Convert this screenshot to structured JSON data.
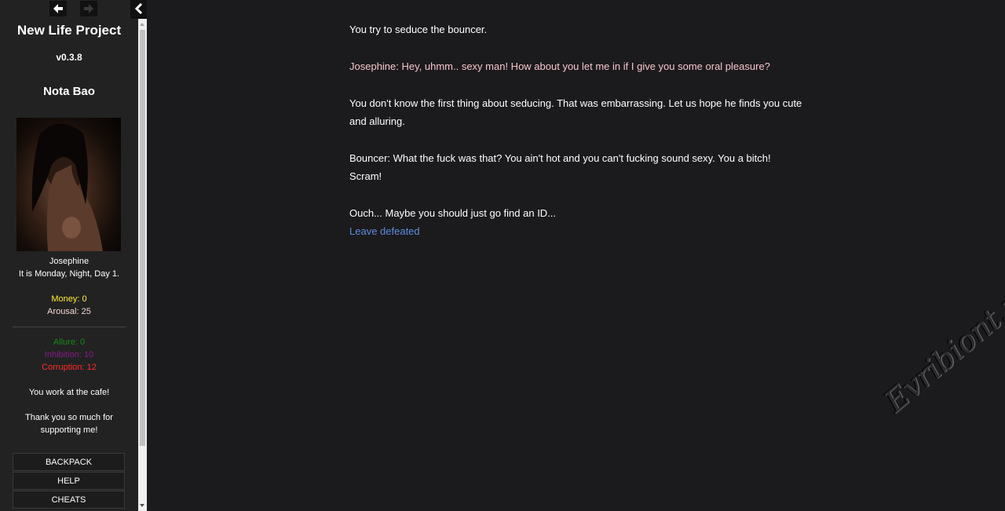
{
  "sidebar": {
    "game_title": "New Life Project",
    "version": "v0.3.8",
    "player_name": "Nota Bao",
    "character_name": "Josephine",
    "date_text": "It is Monday, Night, Day 1.",
    "money_text": "Money: 0",
    "arousal_text": "Arousal: 25",
    "allure_text": "Allure: 0",
    "inhibition_text": "Inhibition: 10",
    "corruption_text": "Corruption: 12",
    "job_text": "You work at the cafe!",
    "thanks_text": "Thank you so much for supporting me!",
    "menu": {
      "backpack": "BACKPACK",
      "help": "HELP",
      "cheats": "CHEATS"
    }
  },
  "passage": {
    "p1": "You try to seduce the bouncer.",
    "p2": "Josephine: Hey, uhmm.. sexy man! How about you let me in if I give you some oral pleasure?",
    "p3": "You don't know the first thing about seducing. That was embarrassing. Let us hope he finds you cute and alluring.",
    "p4": "Bouncer: What the fuck was that? You ain't hot and you can't fucking sound sexy. You a bitch! Scram!",
    "p5": "Ouch... Maybe you should just go find an ID...",
    "link": "Leave defeated"
  },
  "watermark": "Evribiont.ru",
  "colors": {
    "money": "#ffec3a",
    "allure": "#1a8a1a",
    "inhibition": "#8a1a8a",
    "corruption": "#ff2a2a",
    "speech": "#f5c6cb",
    "link": "#5e8cdc"
  },
  "icons": {
    "back": "arrow-left-icon",
    "forward": "arrow-right-icon",
    "collapse": "chevron-left-icon"
  }
}
